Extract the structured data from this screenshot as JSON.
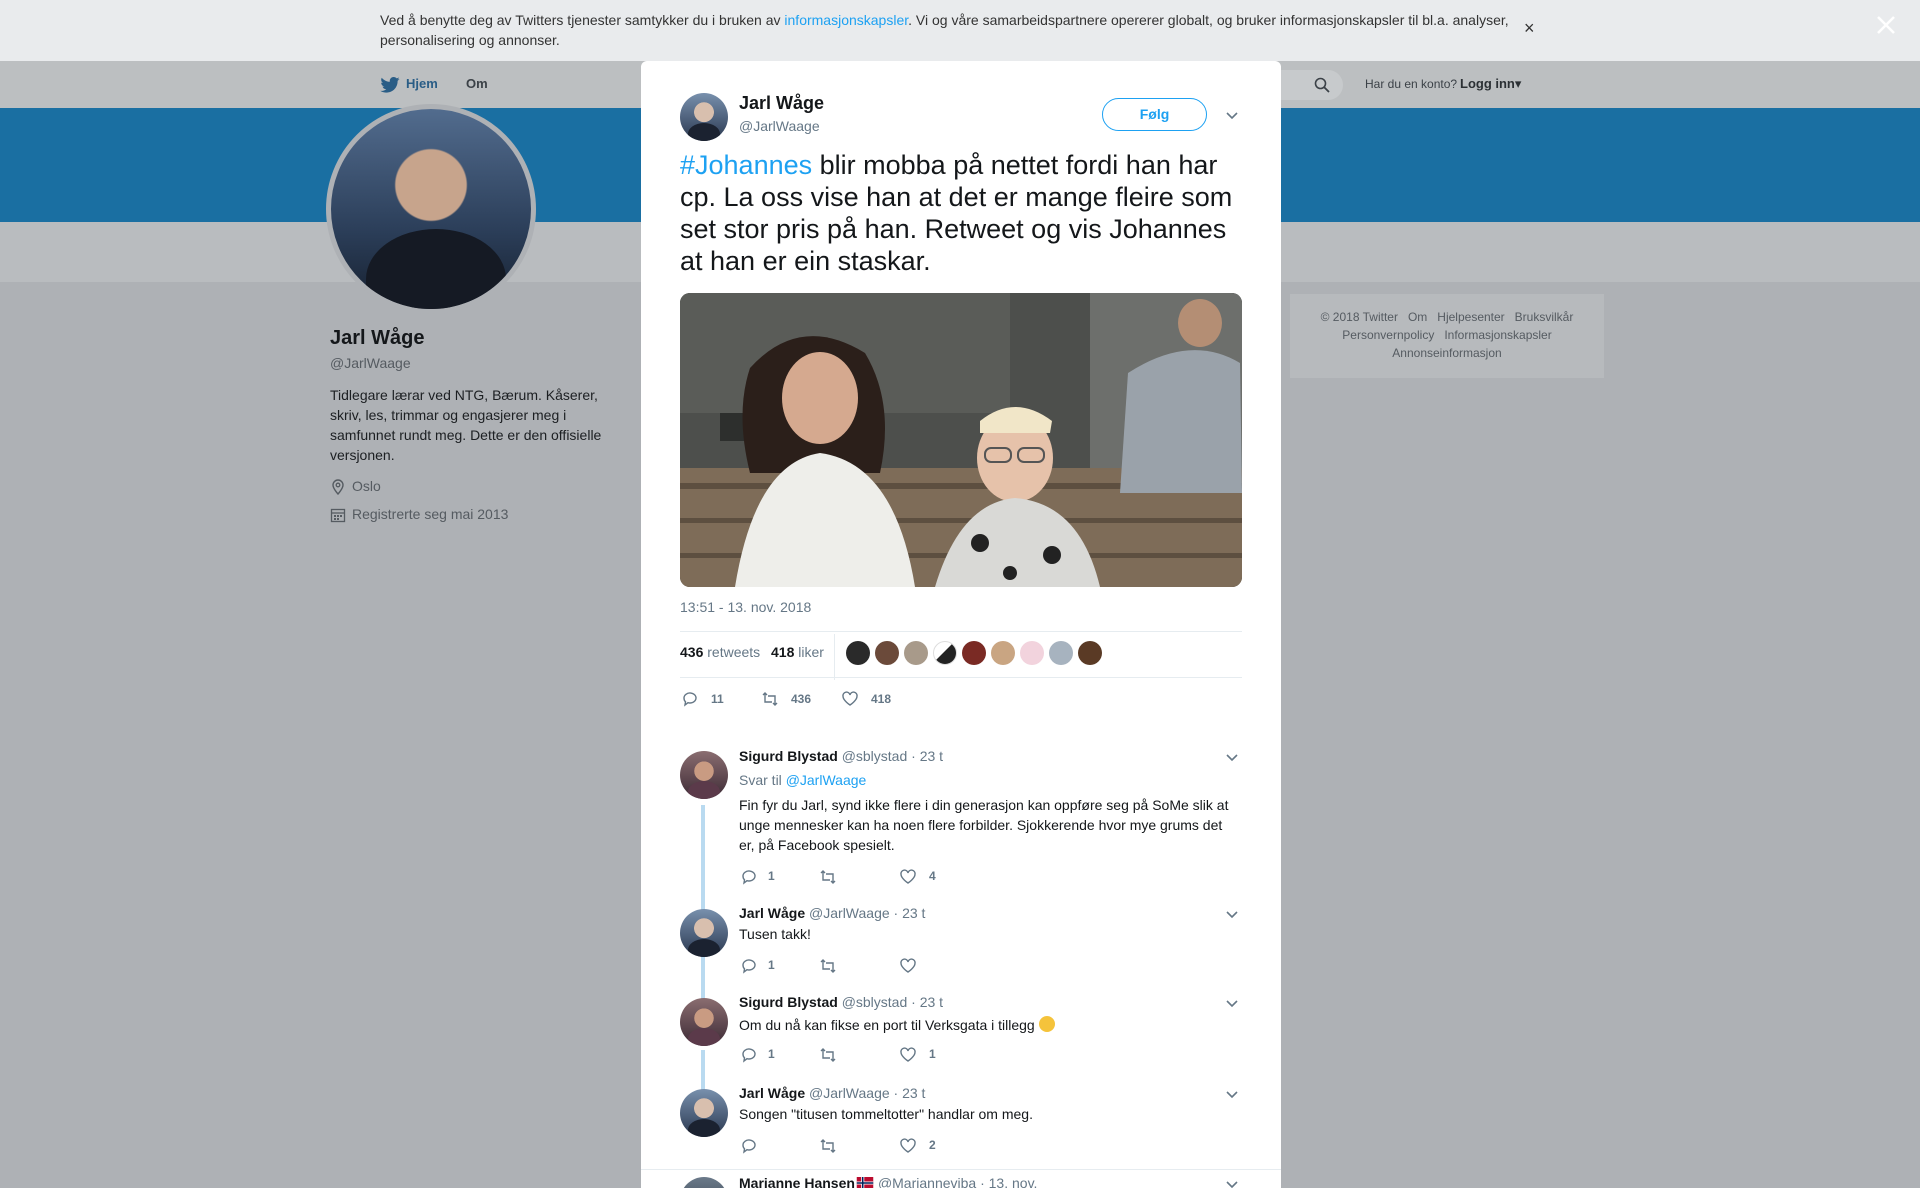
{
  "cookie": {
    "text_before": "Ved å benytte deg av Twitters tjenester samtykker du i bruken av ",
    "link": "informasjonskapsler",
    "text_after": ". Vi og våre samarbeidspartnere opererer globalt, og bruker informasjonskapsler til bl.a. analyser, personalisering og annonser.",
    "close": "×"
  },
  "nav": {
    "home": "Hjem",
    "about": "Om",
    "account_question": "Har du en konto?",
    "login": "Logg inn▾"
  },
  "profile": {
    "name": "Jarl Wåge",
    "handle": "@JarlWaage",
    "bio": "Tidlegare lærar ved NTG, Bærum. Kåserer, skriv, les, trimmar og engasjerer meg i samfunnet rundt meg. Dette er den offisielle versjonen.",
    "location": "Oslo",
    "joined": "Registrerte seg mai 2013"
  },
  "footer": {
    "links": [
      "© 2018 Twitter",
      "Om",
      "Hjelpesenter",
      "Bruksvilkår",
      "Personvernpolicy",
      "Informasjonskapsler",
      "Annonseinformasjon"
    ]
  },
  "tweet": {
    "name": "Jarl Wåge",
    "handle": "@JarlWaage",
    "follow": "Følg",
    "hashtag": "#Johannes",
    "text": " blir mobba på nettet fordi han har cp. La oss vise han at det er mange fleire som set stor pris på han. Retweet og vis Johannes at han er ein staskar.",
    "timestamp": "13:51 - 13. nov. 2018",
    "retweets": "436",
    "retweets_label": "retweets",
    "likes": "418",
    "likes_label": "liker",
    "reply_count": "11",
    "retweet_count": "436",
    "like_count": "418"
  },
  "replies": [
    {
      "name": "Sigurd Blystad",
      "handle": "@sblystad",
      "time": "· 23 t",
      "reply_to_label": "Svar til",
      "reply_to": "@JarlWaage",
      "text": "Fin fyr du Jarl, synd ikke flere i din generasjon kan oppføre seg på SoMe slik at unge mennesker kan ha noen flere forbilder. Sjokkerende hvor mye grums det er, på Facebook spesielt.",
      "replies": "1",
      "retweets": "",
      "likes": "4"
    },
    {
      "name": "Jarl Wåge",
      "handle": "@JarlWaage",
      "time": "· 23 t",
      "text": "Tusen takk!",
      "replies": "1",
      "retweets": "",
      "likes": ""
    },
    {
      "name": "Sigurd Blystad",
      "handle": "@sblystad",
      "time": "· 23 t",
      "text": "Om du nå kan fikse en port til Verksgata i tillegg",
      "replies": "1",
      "retweets": "",
      "likes": "1"
    },
    {
      "name": "Jarl Wåge",
      "handle": "@JarlWaage",
      "time": "· 23 t",
      "text": "Songen \"titusen tommeltotter\" handlar om meg.",
      "replies": "",
      "retweets": "",
      "likes": "2"
    },
    {
      "name": "Marianne Hansen",
      "handle": "@Marianneviba",
      "time": "· 13. nov."
    }
  ],
  "icons": [
    "twitter-bird-icon",
    "search-icon",
    "close-icon",
    "chevron-down-icon",
    "reply-icon",
    "retweet-icon",
    "heart-icon",
    "location-icon",
    "calendar-icon",
    "norway-flag-icon",
    "grin-emoji-icon"
  ],
  "colors": {
    "accent": "#1da1f2",
    "banner": "#1a6fa2",
    "overlay": "#aeb1b5",
    "thread": "#b9daf0"
  }
}
